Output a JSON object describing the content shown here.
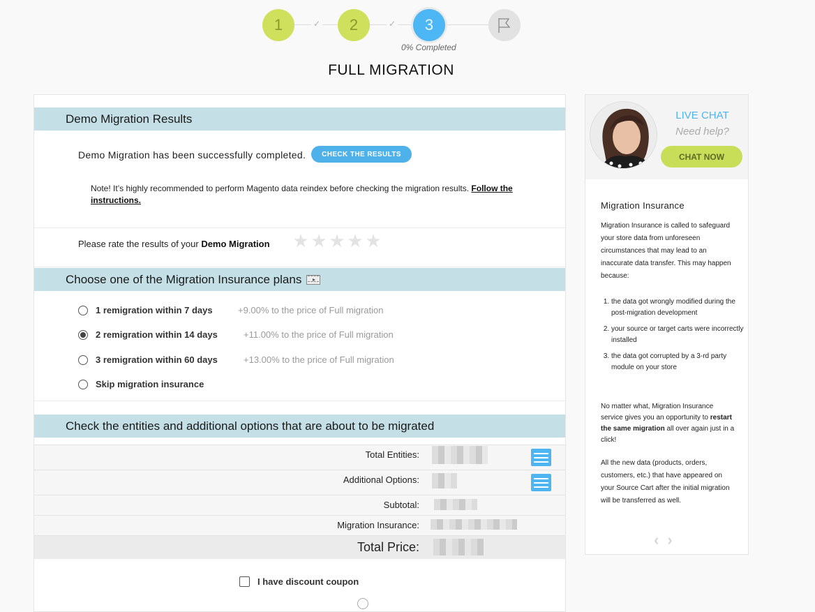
{
  "steps": {
    "items": [
      {
        "label": "1",
        "state": "done"
      },
      {
        "label": "2",
        "state": "done"
      },
      {
        "label": "3",
        "state": "current"
      },
      {
        "label": "",
        "state": "final",
        "icon": "flag-icon"
      }
    ],
    "check_glyph": "✓",
    "progress_text": "0% Completed"
  },
  "page_title": "FULL MIGRATION",
  "demo_results": {
    "heading": "Demo Migration Results",
    "success_text": "Demo Migration has been successfully completed.",
    "check_button": "CHECK THE RESULTS",
    "note_text": "Note! It’s highly recommended to perform Magento data reindex before checking the migration results. ",
    "note_link": "Follow the instructions.",
    "rate_prefix": "Please rate the results of your ",
    "rate_bold": "Demo Migration",
    "rating": {
      "value": 0,
      "max": 5,
      "star_glyph": "★"
    }
  },
  "insurance": {
    "heading": "Choose one of the Migration Insurance plans",
    "plans": [
      {
        "label": "1 remigration within 7 days",
        "extra": "+9.00% to the price of Full migration",
        "selected": false
      },
      {
        "label": "2 remigration within 14 days",
        "extra": "+11.00% to the price of Full migration",
        "selected": true
      },
      {
        "label": "3 remigration within 60 days",
        "extra": "+13.00% to the price of Full migration",
        "selected": false
      },
      {
        "label": "Skip migration insurance",
        "extra": "",
        "selected": false
      }
    ]
  },
  "entities": {
    "heading": "Check the entities and additional options that are about to be migrated",
    "rows": [
      {
        "label": "Total Entities:",
        "value": "[blurred]"
      },
      {
        "label": "Additional Options:",
        "value": "[blurred]"
      },
      {
        "label": "Subtotal:",
        "value": "[blurred]"
      },
      {
        "label": "Migration Insurance:",
        "value": "[blurred]"
      },
      {
        "label": "Total Price:",
        "value": "[blurred]"
      }
    ],
    "coupon_label": "I have discount coupon",
    "coupon_checked": false
  },
  "sidebar": {
    "live_chat": "LIVE CHAT",
    "need_help": "Need help?",
    "chat_button": "CHAT NOW",
    "title": "Migration Insurance",
    "intro": "Migration Insurance is called to safeguard your store data from unforeseen circumstances that may lead to an inaccurate data transfer. This may happen because:",
    "reasons": [
      "the data got wrongly modified during the post-migration development",
      "your source or target carts were incorrectly installed",
      "the data got corrupted by a 3-rd party module on your store"
    ],
    "para2_prefix": "No matter what, Migration Insurance service gives you an opportunity to ",
    "para2_bold": "restart the same migration",
    "para2_suffix": " all over again just in a click!",
    "para3": "All the new data (products, orders, customers, etc.) that have appeared on your Source Cart after the initial migration will be transferred as well.",
    "prev_glyph": "‹",
    "next_glyph": "›"
  }
}
